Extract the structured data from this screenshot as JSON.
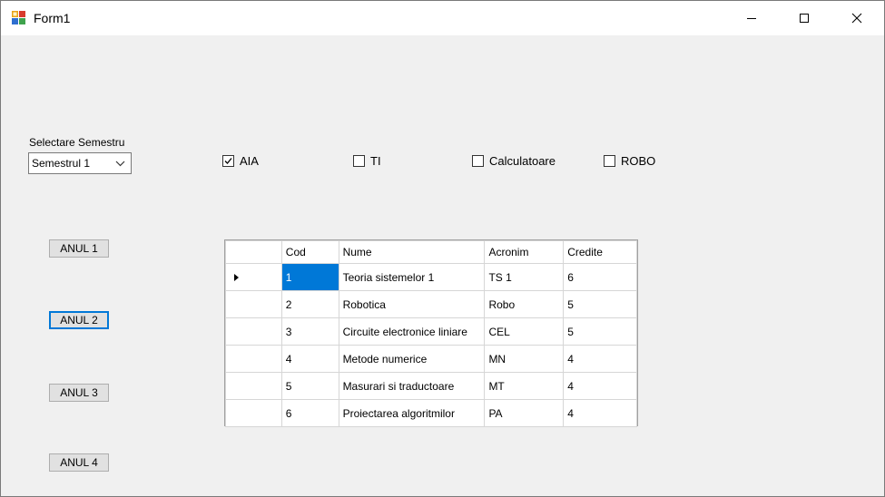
{
  "window": {
    "title": "Form1"
  },
  "semester": {
    "label": "Selectare Semestru",
    "selected": "Semestrul 1"
  },
  "programs": [
    {
      "label": "AIA",
      "checked": true
    },
    {
      "label": "TI",
      "checked": false
    },
    {
      "label": "Calculatoare",
      "checked": false
    },
    {
      "label": "ROBO",
      "checked": false
    }
  ],
  "years": [
    {
      "label": "ANUL 1"
    },
    {
      "label": "ANUL 2"
    },
    {
      "label": "ANUL 3"
    },
    {
      "label": "ANUL 4"
    }
  ],
  "table": {
    "headers": [
      "Cod",
      "Nume",
      "Acronim",
      "Credite"
    ],
    "rows": [
      [
        "1",
        "Teoria sistemelor 1",
        "TS 1",
        "6"
      ],
      [
        "2",
        "Robotica",
        "Robo",
        "5"
      ],
      [
        "3",
        "Circuite electronice liniare",
        "CEL",
        "5"
      ],
      [
        "4",
        "Metode numerice",
        "MN",
        "4"
      ],
      [
        "5",
        "Masurari si traductoare",
        "MT",
        "4"
      ],
      [
        "6",
        "Proiectarea algoritmilor",
        "PA",
        "4"
      ]
    ]
  },
  "icons": {
    "app": "form-app-icon",
    "minimize": "minimize-icon",
    "maximize": "maximize-icon",
    "close": "close-icon",
    "dropdown": "chevron-down-icon",
    "check": "checkmark-icon",
    "current_row": "row-pointer-icon"
  },
  "colors": {
    "selection": "#0078d7",
    "focus": "#0078d7"
  }
}
